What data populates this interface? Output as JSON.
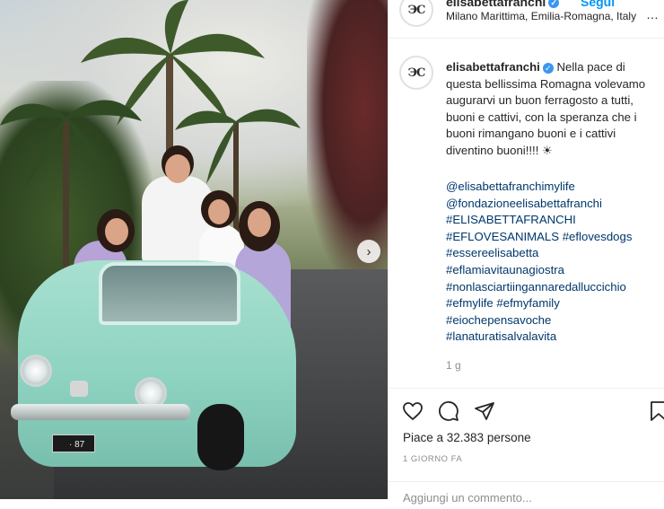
{
  "header": {
    "username": "elisabettafranchi",
    "follow_label": "Segui",
    "location": "Milano Marittima, Emilia-Romagna, Italy",
    "more_label": "…"
  },
  "avatar": {
    "logo_text": "ЭC"
  },
  "photo": {
    "plate_text": "· 87",
    "next_icon": "chevron-right-icon"
  },
  "caption": {
    "username": "elisabettafranchi",
    "text": "Nella pace di questa bellissima Romagna volevamo augurarvi un buon ferragosto a tutti, buoni e cattivi, con la speranza che i buoni rimangano buoni e i cattivi diventino buoni!!!! ☀",
    "hashtags": [
      "@elisabettafranchimylife",
      "@fondazioneelisabettafranchi",
      "#ELISABETTAFRANCHI",
      "#EFLOVESANIMALS #eflovesdogs",
      "#essereelisabetta",
      "#eflamiavitaunagiostra",
      "#nonlasciartiingannaredalluccichio",
      "#efmylife #efmyfamily",
      "#eiochepensavoche",
      "#lanaturatisalvalavita"
    ],
    "time_ago": "1 g"
  },
  "actions": {
    "like_icon": "heart-icon",
    "comment_icon": "comment-icon",
    "share_icon": "share-icon",
    "save_icon": "bookmark-icon"
  },
  "likes": {
    "text": "Piace a 32.383 persone"
  },
  "date": {
    "text": "1 GIORNO FA"
  },
  "comment": {
    "placeholder": "Aggiungi un commento..."
  },
  "colors": {
    "link": "#00376b",
    "follow": "#0095f6",
    "verified": "#3897f0",
    "car": "#8fd3c1"
  }
}
